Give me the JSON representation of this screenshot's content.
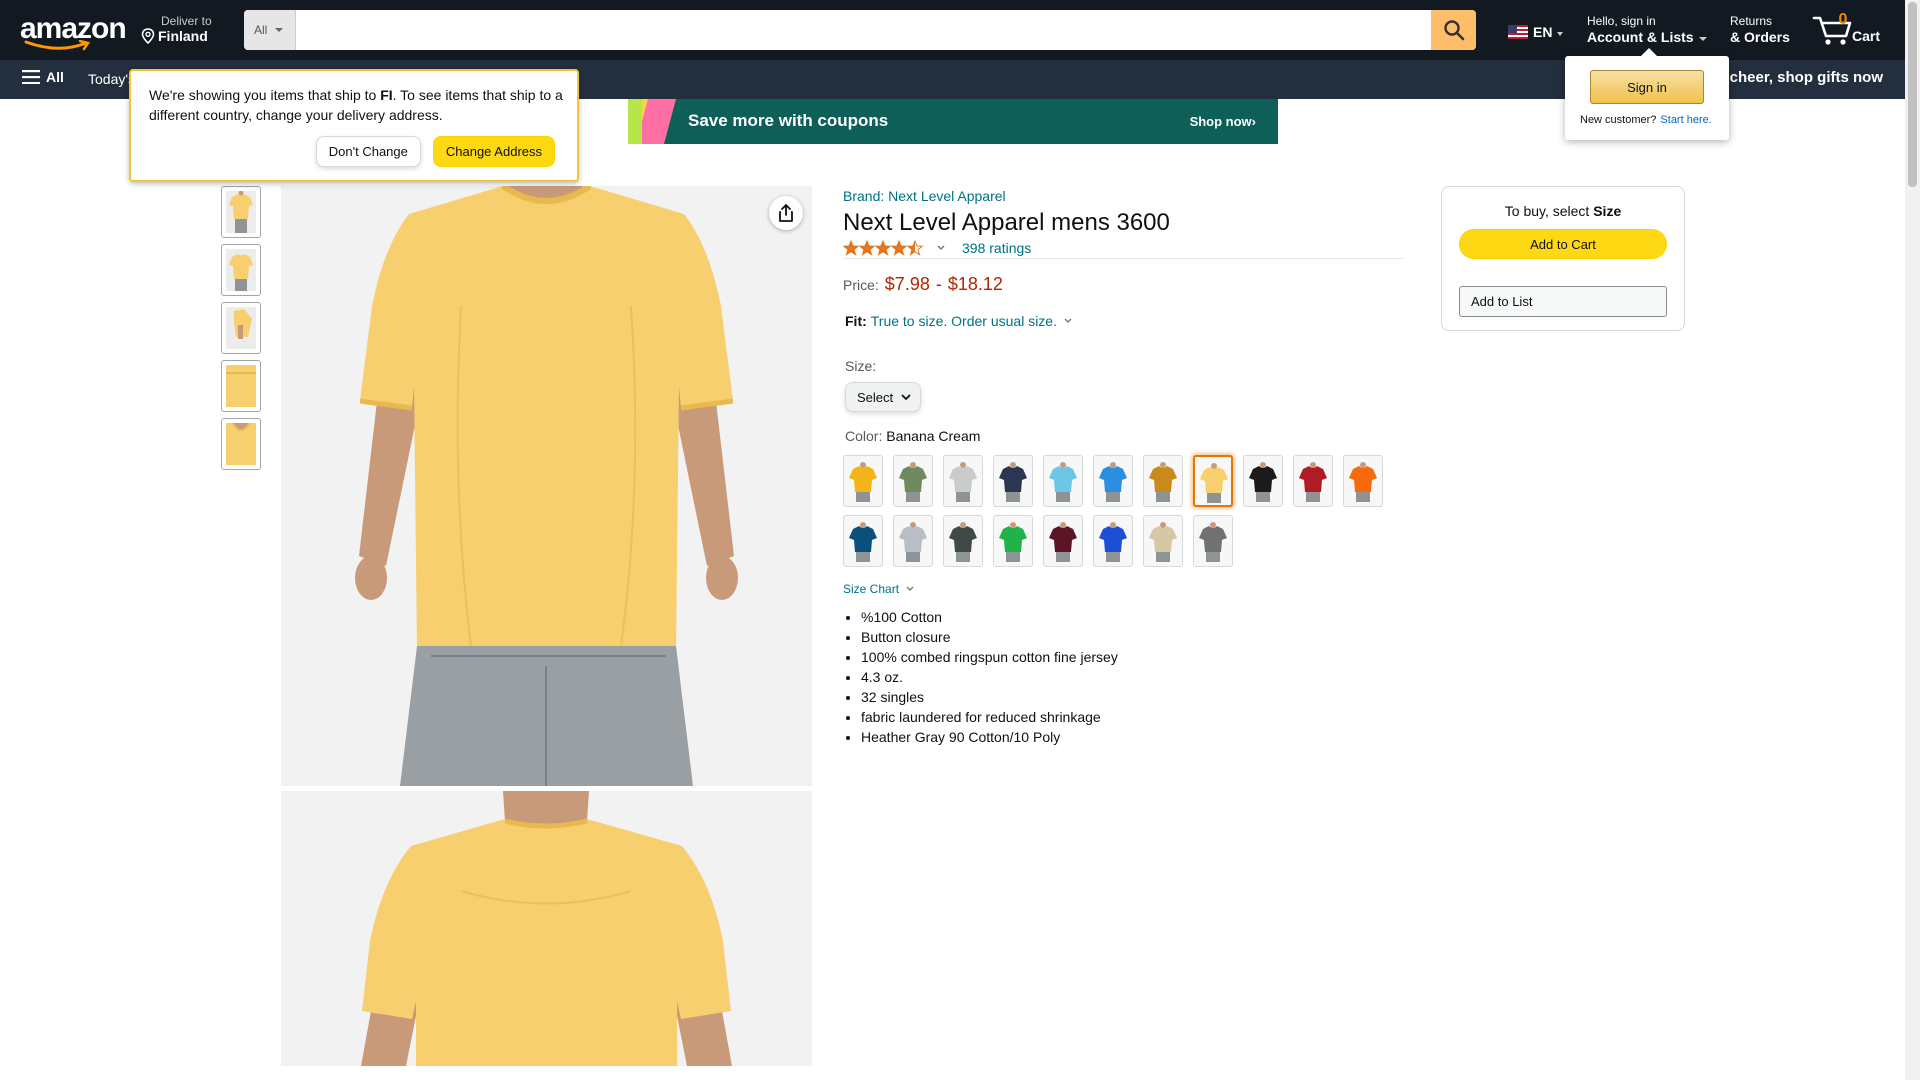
{
  "header": {
    "logo_text": "amazon",
    "deliver_line1": "Deliver to",
    "deliver_line2": "Finland",
    "search_category": "All",
    "search_placeholder": "",
    "language": "EN",
    "account_line1": "Hello, sign in",
    "account_line2": "Account & Lists",
    "returns_line1": "Returns",
    "returns_line2": "& Orders",
    "cart_count": "0",
    "cart_label": "Cart"
  },
  "nav": {
    "all_label": "All",
    "today_label": "Today's",
    "promo_text": "e cheer, shop gifts now"
  },
  "coupon_banner": {
    "headline": "Save more with coupons",
    "cta": "Shop now›"
  },
  "ship_popover": {
    "message_pre": "We're showing you items that ship to ",
    "country_code": "FI",
    "message_post": ". To see items that ship to a different country, change your delivery address.",
    "dont_change": "Don't Change",
    "change_address": "Change Address"
  },
  "signin_popover": {
    "button": "Sign in",
    "new_customer": "New customer?",
    "start_here": "Start here."
  },
  "product": {
    "brand": "Brand: Next Level Apparel",
    "title": "Next Level Apparel mens 3600",
    "rating_stars": 4.5,
    "ratings_count": "398 ratings",
    "price_label": "Price:",
    "price_low": "$7.98",
    "price_sep": "-",
    "price_high": "$18.12",
    "fit_label": "Fit:",
    "fit_value": "True to size. Order usual size.",
    "size_label": "Size:",
    "size_select_value": "Select",
    "color_label": "Color:",
    "color_value": "Banana Cream",
    "size_chart": "Size Chart",
    "bullets": [
      "%100 Cotton",
      "Button closure",
      "100% combed ringspun cotton fine jersey",
      "4.3 oz.",
      "32 singles",
      "fabric laundered for reduced shrinkage",
      "Heather Gray 90 Cotton/10 Poly"
    ],
    "main_shirt_color": "#f7cf6e",
    "swatches": [
      {
        "color": "#f2b418"
      },
      {
        "color": "#6f8a5e"
      },
      {
        "color": "#c9cbcd"
      },
      {
        "color": "#2c3552"
      },
      {
        "color": "#6ec6e6"
      },
      {
        "color": "#2a8fe0"
      },
      {
        "color": "#c98a1c"
      },
      {
        "color": "#f7cf6e",
        "selected": true
      },
      {
        "color": "#1b1b1b"
      },
      {
        "color": "#b01c24"
      },
      {
        "color": "#f76a0c"
      },
      {
        "color": "#0b4f7c"
      },
      {
        "color": "#b9bdc4"
      },
      {
        "color": "#3f4a45"
      },
      {
        "color": "#22b24a"
      },
      {
        "color": "#5a1626"
      },
      {
        "color": "#1a4fd6"
      },
      {
        "color": "#d6c7a5"
      },
      {
        "color": "#707272"
      }
    ]
  },
  "buy_box": {
    "hint_pre": "To buy, select ",
    "hint_bold": "Size",
    "add_to_cart": "Add to Cart",
    "add_to_list": "Add to List"
  }
}
